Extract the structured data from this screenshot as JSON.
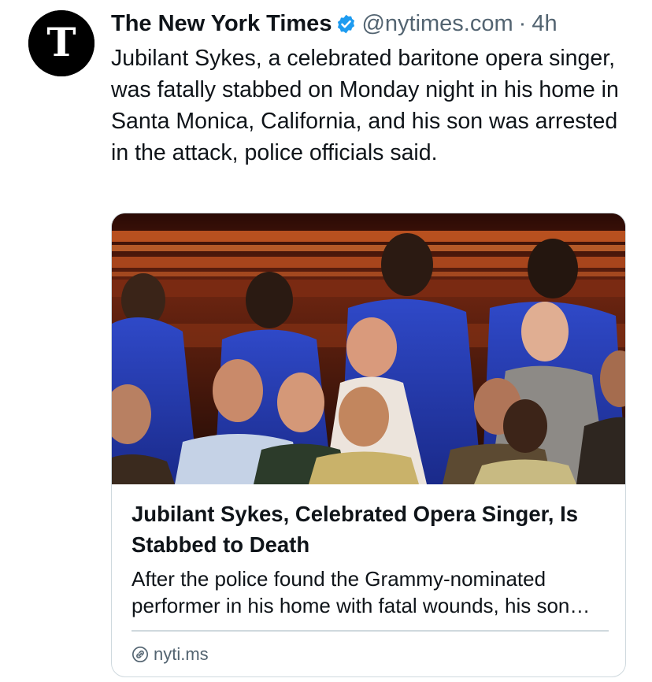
{
  "post": {
    "author": {
      "display_name": "The New York Times",
      "verified": true,
      "handle": "@nytimes.com",
      "separator": "·",
      "time_ago": "4h",
      "avatar_letter": "T",
      "avatar_icon": "nyt-logo-icon"
    },
    "text": "Jubilant Sykes, a celebrated baritone opera singer, was fatally stabbed on Monday night in his home in Santa Monica, California, and his son was arrested in the attack, police officials said.",
    "link_card": {
      "image_icon": "choir-performance-photo",
      "title": "Jubilant Sykes, Celebrated Opera Singer, Is Stabbed to Death",
      "description": "After the police found the Grammy-nominated performer in his home with fatal wounds, his son was arrested in the attack.",
      "domain": "nyti.ms",
      "domain_icon": "link-icon"
    }
  },
  "colors": {
    "text_primary": "#0f1419",
    "text_secondary": "#536471",
    "verified_blue": "#1d9bf0",
    "border": "#cfd9de"
  }
}
